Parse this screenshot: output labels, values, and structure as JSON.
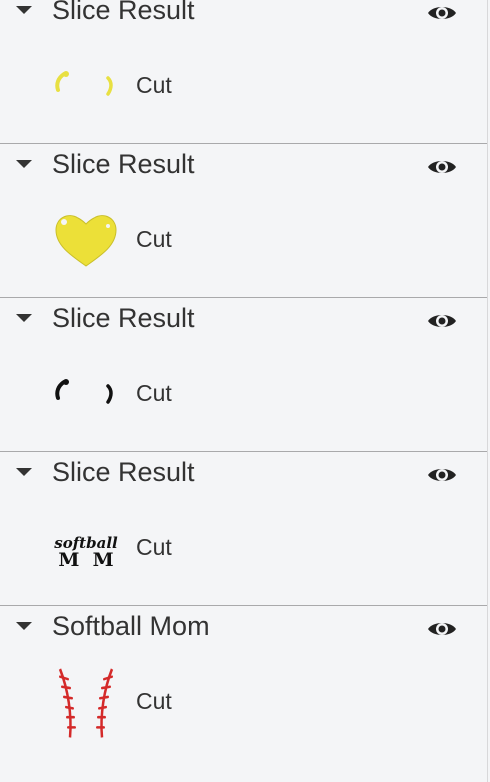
{
  "groups": [
    {
      "title": "Slice Result",
      "layer_label": "Cut",
      "thumb": "yellow-stitches",
      "color": "#e8e042"
    },
    {
      "title": "Slice Result",
      "layer_label": "Cut",
      "thumb": "yellow-heart",
      "color": "#ece038"
    },
    {
      "title": "Slice Result",
      "layer_label": "Cut",
      "thumb": "black-stitches",
      "color": "#111111"
    },
    {
      "title": "Slice Result",
      "layer_label": "Cut",
      "thumb": "softball-mom-text",
      "color": "#111111",
      "thumb_text_top": "softball",
      "thumb_text_bottom": "M  M"
    },
    {
      "title": "Softball Mom",
      "layer_label": "Cut",
      "thumb": "red-seams",
      "color": "#d42a2a"
    }
  ],
  "icons": {
    "visibility": "eye-icon",
    "expand": "caret-down-icon"
  }
}
